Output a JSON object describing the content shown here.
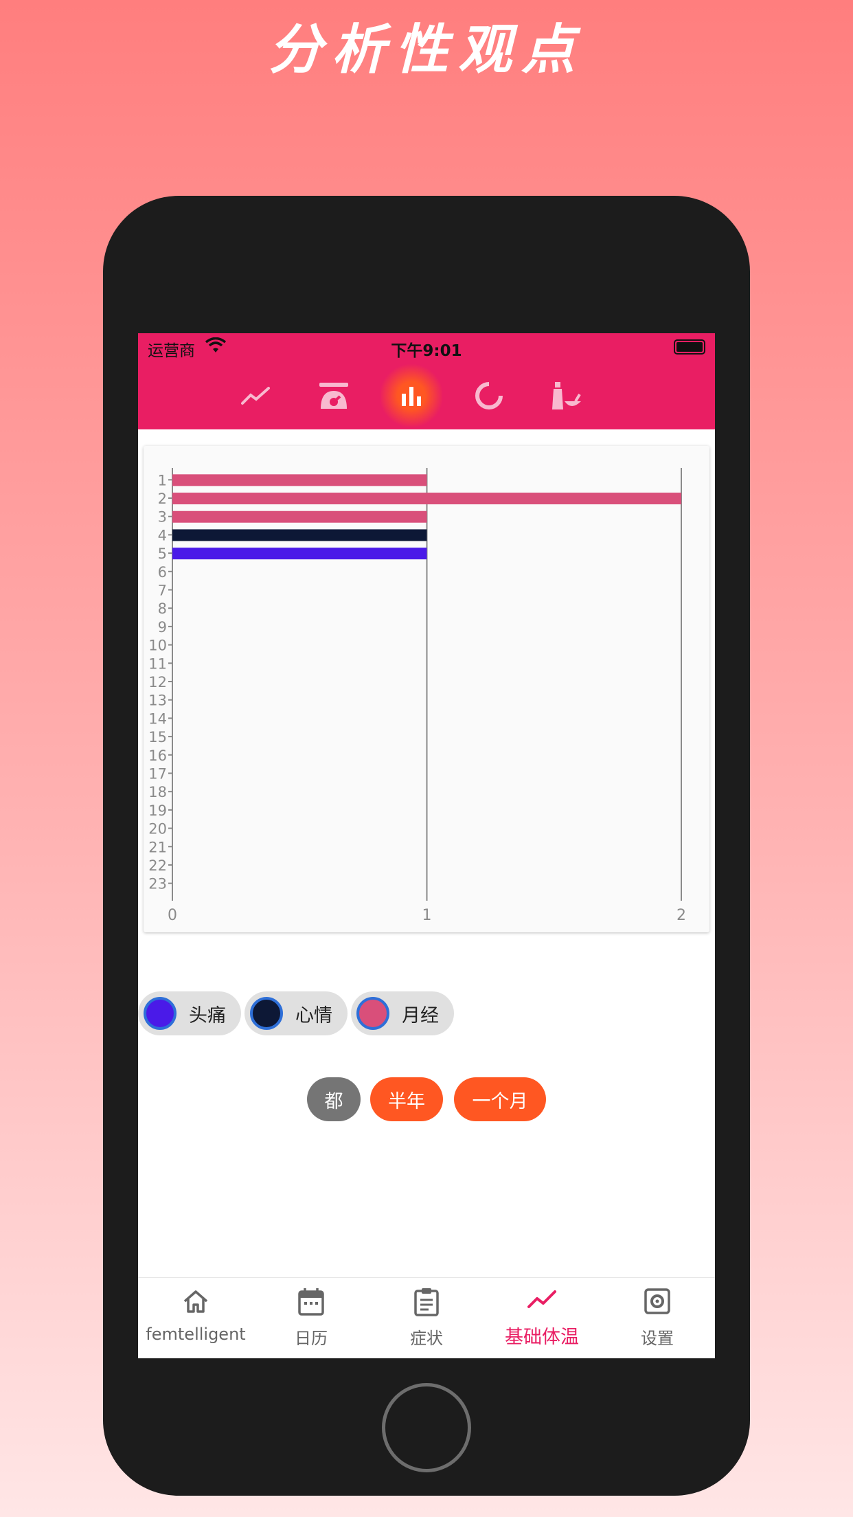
{
  "promo": {
    "title": "分析性观点"
  },
  "status_bar": {
    "carrier": "运营商",
    "time": "下午9:01"
  },
  "top_tabs": [
    {
      "icon": "line-chart-icon"
    },
    {
      "icon": "scale-icon"
    },
    {
      "icon": "bar-chart-icon",
      "active": true
    },
    {
      "icon": "donut-chart-icon"
    },
    {
      "icon": "bottle-bowl-icon"
    }
  ],
  "chart_data": {
    "type": "bar",
    "orientation": "horizontal",
    "categories": [
      "1",
      "2",
      "3",
      "4",
      "5",
      "6",
      "7",
      "8",
      "9",
      "10",
      "11",
      "12",
      "13",
      "14",
      "15",
      "16",
      "17",
      "18",
      "19",
      "20",
      "21",
      "22",
      "23"
    ],
    "values": [
      1,
      2,
      1,
      1,
      1,
      0,
      0,
      0,
      0,
      0,
      0,
      0,
      0,
      0,
      0,
      0,
      0,
      0,
      0,
      0,
      0,
      0,
      0
    ],
    "bar_colors": [
      "#d94f7a",
      "#d94f7a",
      "#d94f7a",
      "#0d1836",
      "#4a1ae8"
    ],
    "x_ticks": [
      "0",
      "1",
      "2"
    ],
    "xlim": [
      0,
      2
    ],
    "grid": "vertical"
  },
  "legend_chips": [
    {
      "label": "头痛",
      "color": "#4a1ae8"
    },
    {
      "label": "心情",
      "color": "#0d1836"
    },
    {
      "label": "月经",
      "color": "#d94f7a"
    }
  ],
  "range_buttons": [
    {
      "label": "都",
      "color": "#757575"
    },
    {
      "label": "半年",
      "color": "#ff5722"
    },
    {
      "label": "一个月",
      "color": "#ff5722"
    }
  ],
  "bottom_nav": [
    {
      "label": "femtelligent",
      "icon": "home-icon"
    },
    {
      "label": "日历",
      "icon": "calendar-icon"
    },
    {
      "label": "症状",
      "icon": "clipboard-icon"
    },
    {
      "label": "基础体温",
      "icon": "trend-icon",
      "active": true
    },
    {
      "label": "设置",
      "icon": "settings-icon"
    }
  ],
  "colors": {
    "primary": "#e91e63",
    "accent": "#ff5722"
  }
}
